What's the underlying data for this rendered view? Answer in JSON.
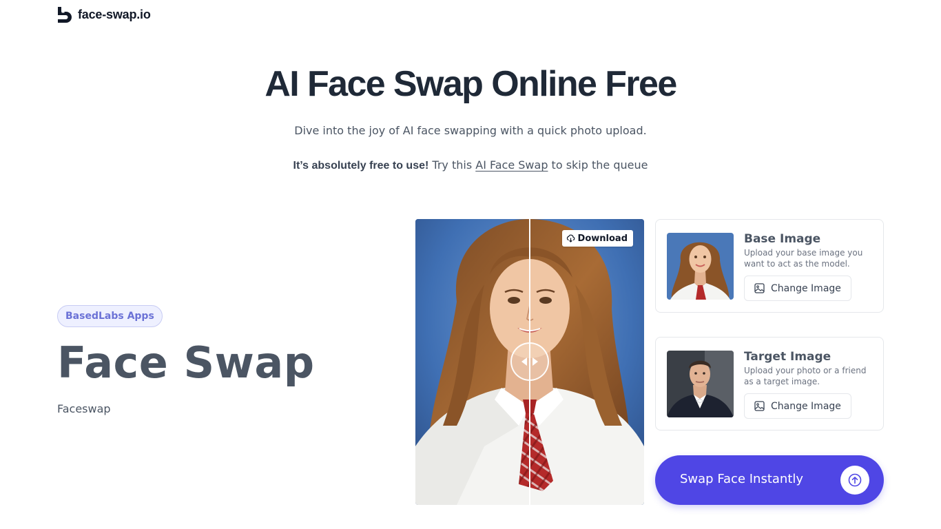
{
  "header": {
    "logo_text": "face-swap.io"
  },
  "hero": {
    "title": "AI Face Swap Online Free",
    "subtitle": "Dive into the joy of AI face swapping with a quick photo upload.",
    "free_bold": "It’s absolutely free to use!",
    "free_pre_link": " Try this ",
    "free_link": "AI Face Swap",
    "free_post_link": " to skip the queue"
  },
  "app": {
    "badge": "BasedLabs Apps",
    "title": "Face Swap",
    "subtitle": "Faceswap"
  },
  "compare": {
    "download_label": "Download",
    "download_icon": "cloud-download-icon",
    "slider_icon": "left-right-arrows-icon"
  },
  "base_card": {
    "title": "Base Image",
    "description": "Upload your base image you want to act as the model.",
    "button_label": "Change Image",
    "button_icon": "image-icon"
  },
  "target_card": {
    "title": "Target Image",
    "description": "Upload your photo or a friend as a target image.",
    "button_label": "Change Image",
    "button_icon": "image-icon"
  },
  "swap": {
    "label": "Swap Face Instantly",
    "icon": "upload-arrow-icon"
  },
  "colors": {
    "accent": "#4f46e5",
    "badge_bg": "#eef0ff",
    "badge_text": "#6b72d6",
    "heading": "#1f2937",
    "muted": "#4b5563"
  }
}
